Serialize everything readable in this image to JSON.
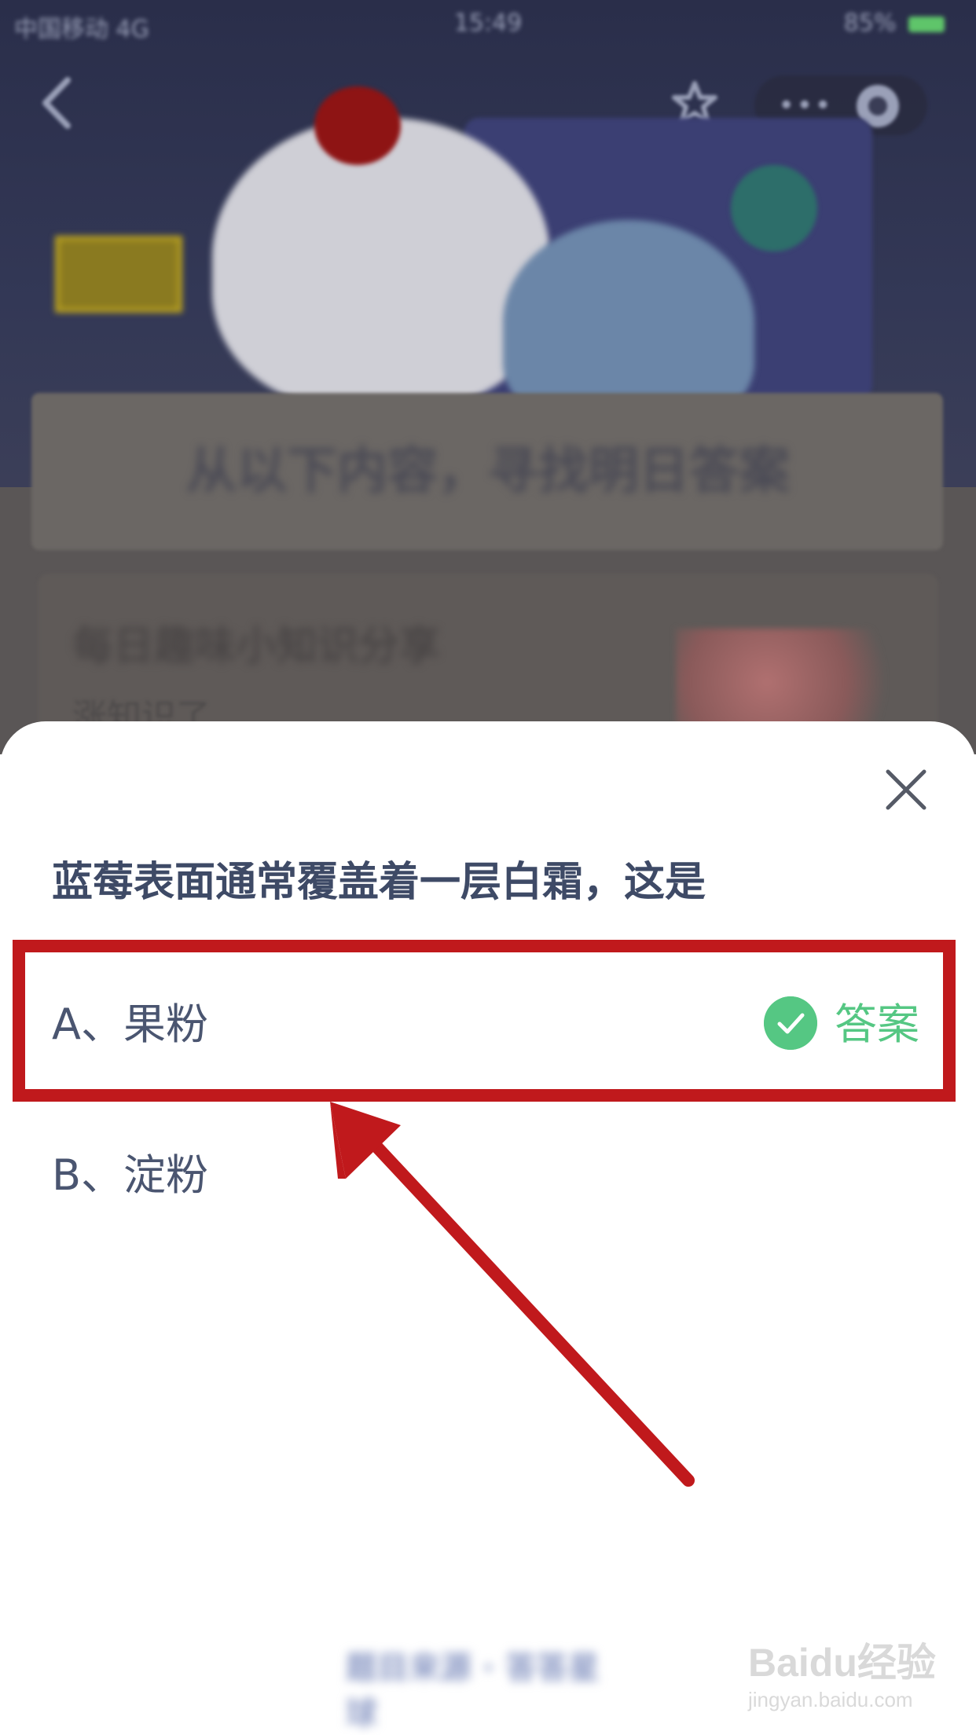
{
  "status_bar": {
    "carrier": "中国移动 4G",
    "time": "15:49",
    "battery": "85%"
  },
  "background_page": {
    "main_title": "从以下内容，寻找明日答案",
    "card_title": "每日趣味小知识分享",
    "card_subtitle": "涨知识了"
  },
  "quiz": {
    "question": "蓝莓表面通常覆盖着一层白霜，这是",
    "options": [
      {
        "label": "A、果粉",
        "is_answer": true
      },
      {
        "label": "B、淀粉",
        "is_answer": false
      }
    ],
    "answer_tag": "答案"
  },
  "bottom_link": "题目来源 · 答答星球",
  "watermark": {
    "logo": "Baidu经验",
    "url": "jingyan.baidu.com"
  },
  "colors": {
    "answer_green": "#55c783",
    "highlight_red": "#c0191c",
    "question_text": "#3e4a66"
  },
  "icons": [
    "back-icon",
    "star-icon",
    "more-icon",
    "target-icon",
    "close-icon",
    "check-icon"
  ]
}
